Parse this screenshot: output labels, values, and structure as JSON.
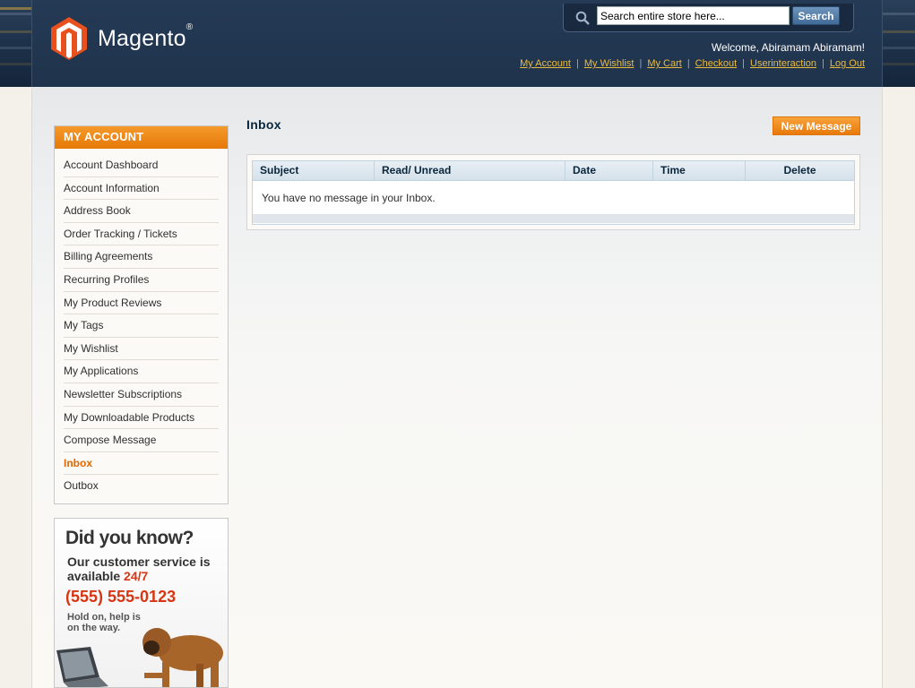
{
  "header": {
    "brand": "Magento",
    "brand_mark": "®",
    "search": {
      "placeholder": "Search entire store here...",
      "value": "Search entire store here...",
      "button": "Search"
    },
    "welcome": "Welcome, Abiramam Abiramam!",
    "links": [
      "My Account",
      "My Wishlist",
      "My Cart",
      "Checkout",
      "Userinteraction",
      "Log Out"
    ]
  },
  "sidebar": {
    "title": "MY ACCOUNT",
    "items": [
      "Account Dashboard",
      "Account Information",
      "Address Book",
      "Order Tracking / Tickets",
      "Billing Agreements",
      "Recurring Profiles",
      "My Product Reviews",
      "My Tags",
      "My Wishlist",
      "My Applications",
      "Newsletter Subscriptions",
      "My Downloadable Products",
      "Compose Message",
      "Inbox",
      "Outbox"
    ],
    "active": "Inbox"
  },
  "promo": {
    "title": "Did you know?",
    "line1": "Our customer service is",
    "line2a": "available ",
    "line2b": "24/7",
    "phone": "(555) 555-0123",
    "note": "Hold on, help is on the way."
  },
  "main": {
    "title": "Inbox",
    "new_message": "New Message",
    "columns": [
      "Subject",
      "Read/ Unread",
      "Date",
      "Time",
      "Delete"
    ],
    "empty_text": "You have no message in your Inbox."
  },
  "colors": {
    "accent": "#e8780a",
    "header_bg": "#1f334c",
    "link_yellow": "#ebbb40",
    "logo_red": "#e8501e"
  },
  "icons": [
    "magento-logo-icon",
    "search-icon",
    "laptop-icon",
    "dog-image"
  ]
}
